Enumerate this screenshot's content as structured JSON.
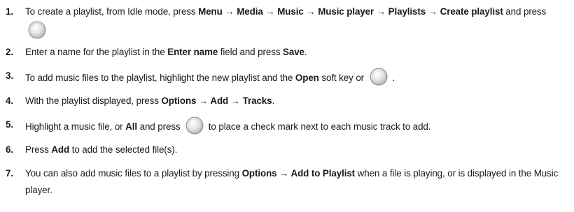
{
  "steps": [
    {
      "number": "1.",
      "segments": [
        {
          "text": "To create a playlist, from Idle mode, press ",
          "bold": false
        },
        {
          "text": "Menu → Media → Music → Music player → Playlists → Create playlist",
          "bold": true
        },
        {
          "text": " and press ",
          "bold": false
        },
        {
          "icon": "center-select-key-icon"
        }
      ]
    },
    {
      "number": "2.",
      "segments": [
        {
          "text": "Enter a name for the playlist in the ",
          "bold": false
        },
        {
          "text": "Enter name",
          "bold": true
        },
        {
          "text": " field and press ",
          "bold": false
        },
        {
          "text": "Save",
          "bold": true
        },
        {
          "text": ".",
          "bold": false
        }
      ]
    },
    {
      "number": "3.",
      "segments": [
        {
          "text": "To add music files to the playlist, highlight the new playlist and the ",
          "bold": false
        },
        {
          "text": "Open",
          "bold": true
        },
        {
          "text": " soft key or ",
          "bold": false
        },
        {
          "icon": "center-select-key-icon"
        },
        {
          "text": " .",
          "bold": false
        }
      ]
    },
    {
      "number": "4.",
      "segments": [
        {
          "text": "With the playlist displayed, press ",
          "bold": false
        },
        {
          "text": "Options  → Add → Tracks",
          "bold": true
        },
        {
          "text": ".",
          "bold": false
        }
      ]
    },
    {
      "number": "5.",
      "segments": [
        {
          "text": "Highlight a music file, or ",
          "bold": false
        },
        {
          "text": "All",
          "bold": true
        },
        {
          "text": " and press ",
          "bold": false
        },
        {
          "icon": "center-select-key-icon"
        },
        {
          "text": " to place a check mark next to each music track to add.",
          "bold": false
        }
      ]
    },
    {
      "number": "6.",
      "segments": [
        {
          "text": "Press ",
          "bold": false
        },
        {
          "text": "Add",
          "bold": true
        },
        {
          "text": " to add the selected file(s).",
          "bold": false
        }
      ]
    },
    {
      "number": "7.",
      "segments": [
        {
          "text": "You can also add music files to a playlist by pressing ",
          "bold": false
        },
        {
          "text": "Options → Add to Playlist",
          "bold": true
        },
        {
          "text": " when a file is playing, or is displayed in the Music player.",
          "bold": false
        }
      ]
    }
  ]
}
